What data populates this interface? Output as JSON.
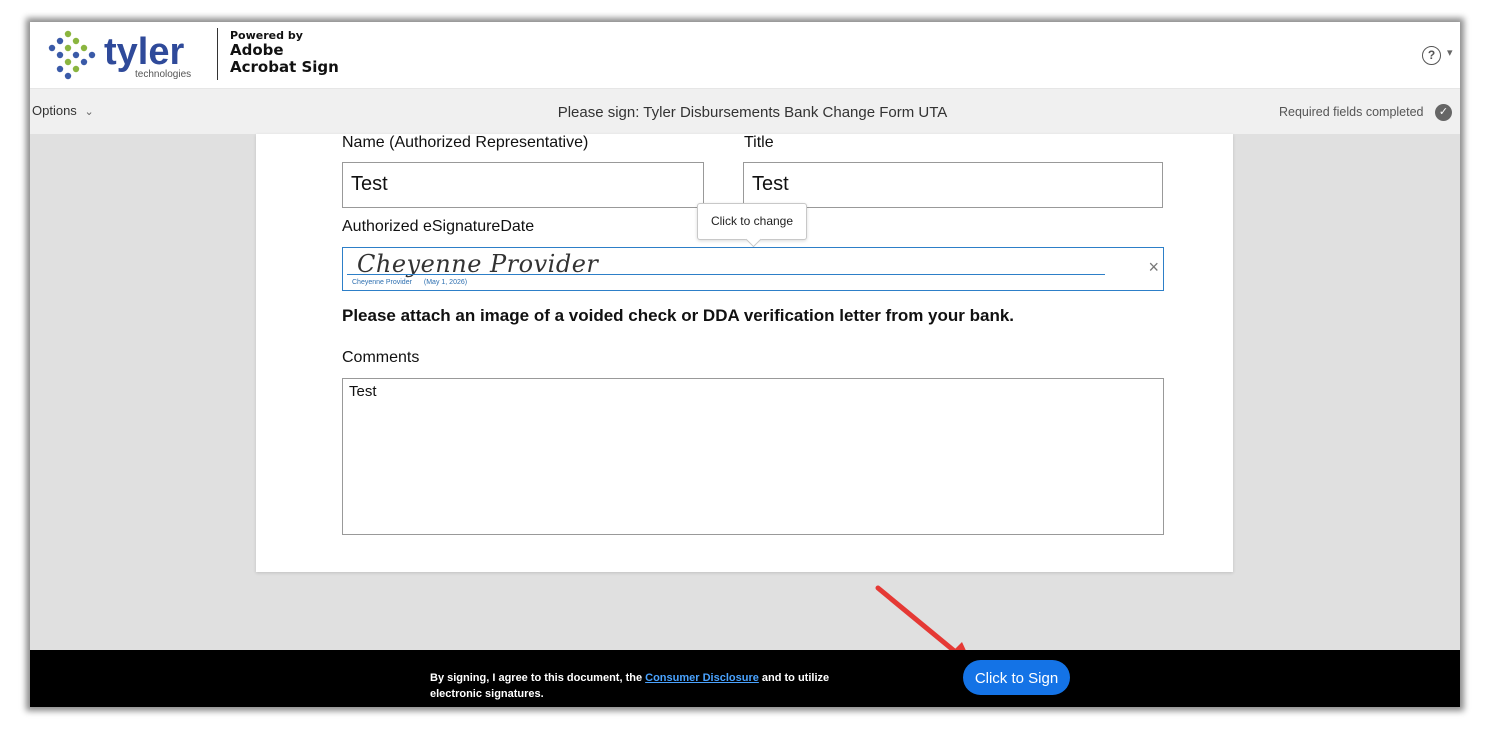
{
  "header": {
    "logo_text": "tyler",
    "logo_subtext": "technologies",
    "powered_by": "Powered by",
    "brand_line1": "Adobe",
    "brand_line2": "Acrobat Sign",
    "help_icon": "question-circle-icon",
    "help_glyph": "?",
    "caret_glyph": "▾"
  },
  "subbar": {
    "options_label": "Options",
    "options_chevron": "⌄",
    "document_title": "Please sign: Tyler Disbursements Bank Change Form UTA",
    "status_text": "Required fields completed",
    "status_icon": "check-circle-icon",
    "status_glyph": "✓"
  },
  "form": {
    "name_label": "Name (Authorized Representative)",
    "name_value": "Test",
    "title_label": "Title",
    "title_value": "Test",
    "signature_label": "Authorized eSignatureDate",
    "tooltip": "Click to change",
    "signature_script": "Cheyenne Provider",
    "signature_caption_name": "Cheyenne Provider",
    "signature_caption_date": "(May 1, 2026)",
    "clear_glyph": "×",
    "attach_notice": "Please attach an image of a voided check or DDA verification letter from your bank.",
    "comments_label": "Comments",
    "comments_value": "Test"
  },
  "footer": {
    "consent_prefix": "By signing, I agree to this document, the",
    "consent_link": "Consumer Disclosure",
    "consent_suffix": "and to utilize electronic signatures.",
    "sign_button": "Click to Sign"
  },
  "colors": {
    "accent": "#1473e6",
    "signature_border": "#2d7fc8",
    "annotation_arrow": "#e53935",
    "footer_bg": "#000000"
  }
}
